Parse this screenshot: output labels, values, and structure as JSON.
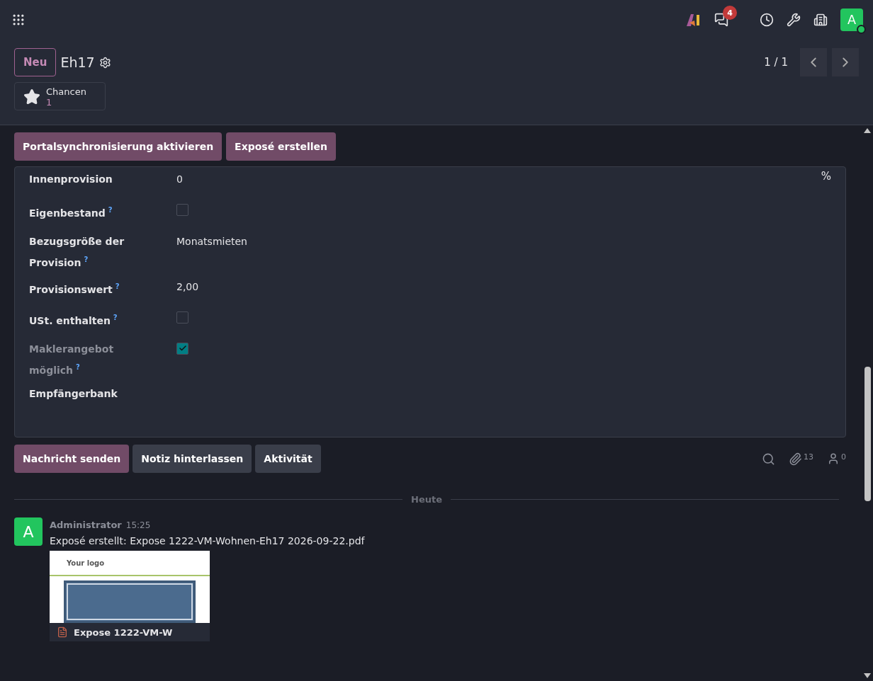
{
  "navbar": {
    "chat_badge": "4",
    "avatar": "A",
    "online": true
  },
  "header": {
    "new_button": "Neu",
    "title": "Eh17",
    "pager": "1 / 1"
  },
  "smart_buttons": [
    {
      "label": "Chancen",
      "value": "1"
    }
  ],
  "action_buttons": [
    "Portalsynchronisierung aktivieren",
    "Exposé erstellen"
  ],
  "fields": [
    {
      "kind": "text",
      "label": "Innenprovision",
      "value": "0",
      "suffix": "%",
      "readonly": false
    },
    {
      "kind": "checkbox",
      "label": "Eigenbestand",
      "help": "?",
      "checked": false,
      "readonly": false
    },
    {
      "kind": "text",
      "label": "Bezugsgröße der Provision",
      "help": "?",
      "value": "Monatsmieten",
      "readonly": false
    },
    {
      "kind": "text",
      "label": "Provisionswert",
      "help": "?",
      "value": "2,00",
      "readonly": false
    },
    {
      "kind": "checkbox",
      "label": "USt. enthalten",
      "help": "?",
      "checked": false,
      "readonly": false
    },
    {
      "kind": "checkbox",
      "label": "Maklerangebot möglich",
      "help": "?",
      "checked": true,
      "readonly": true
    },
    {
      "kind": "text",
      "label": "Empfängerbank",
      "readonly": false
    }
  ],
  "chatter": {
    "buttons": [
      {
        "label": "Nachricht senden",
        "primary": true
      },
      {
        "label": "Notiz hinterlassen",
        "primary": false
      },
      {
        "label": "Aktivität",
        "primary": false
      }
    ],
    "attachments": "13",
    "followers": "0"
  },
  "date_separator": "Heute",
  "messages": [
    {
      "avatar": "A",
      "author": "Administrator",
      "time": "15:25",
      "body": "Exposé erstellt: Expose 1222-VM-Wohnen-Eh17 2026-09-22.pdf",
      "attachment": {
        "preview_logo": "Your logo",
        "name": "Expose 1222-VM-W"
      }
    }
  ]
}
